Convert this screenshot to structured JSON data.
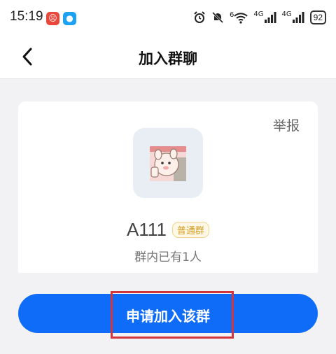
{
  "status_bar": {
    "time": "15:19",
    "battery": "92",
    "notification_icons": [
      "weibo-icon",
      "message-icon"
    ],
    "system_icons": [
      "alarm-icon",
      "mute-icon",
      "wifi-icon",
      "signal-4g-icon",
      "signal-4g-icon"
    ],
    "signal_label_1": "4G",
    "signal_label_2": "4G",
    "wifi_label": "6"
  },
  "header": {
    "title": "加入群聊",
    "back_icon": "chevron-left-icon"
  },
  "group": {
    "report_label": "举报",
    "name": "A111",
    "type_badge": "普通群",
    "member_text": "群内已有1人",
    "avatar_icon": "group-avatar-image"
  },
  "action": {
    "join_label": "申请加入该群"
  },
  "colors": {
    "primary": "#0e6cf9",
    "highlight": "#d0363b",
    "badge": "#d39a1e",
    "background": "#f2f2f5"
  }
}
